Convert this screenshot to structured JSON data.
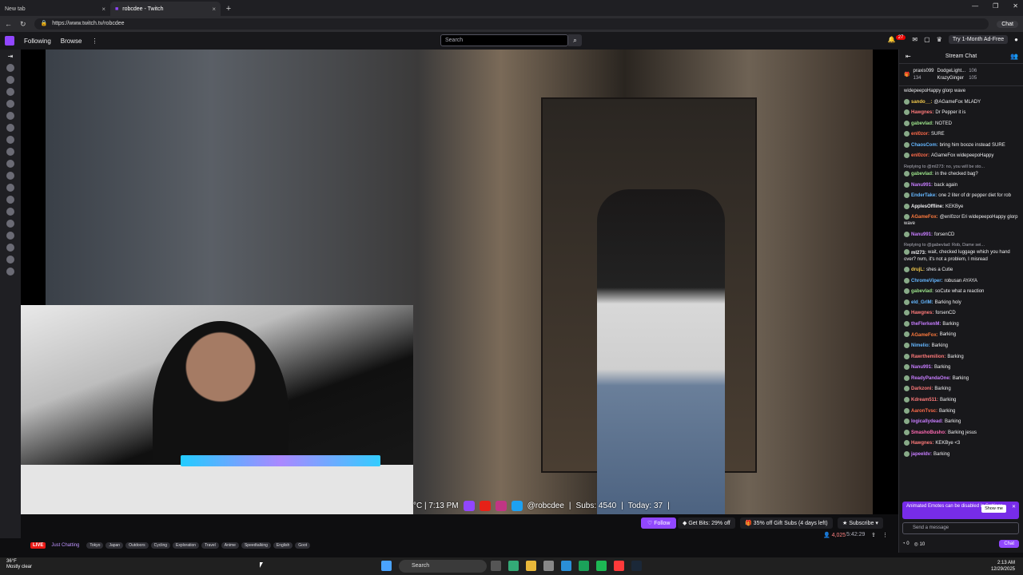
{
  "browser": {
    "tabs": [
      {
        "title": "New tab",
        "active": false
      },
      {
        "title": "robcdee - Twitch",
        "active": true
      }
    ],
    "url": "https://www.twitch.tv/robcdee",
    "chat_button": "Chat"
  },
  "twitch_nav": {
    "following": "Following",
    "browse": "Browse",
    "search_placeholder": "Search",
    "notification_count": "27",
    "ad_free": "Try 1-Month Ad-Free"
  },
  "stream": {
    "ticker": {
      "time": "°C | 7:13 PM",
      "handle": "@robcdee",
      "subs": "Subs: 4540",
      "today": "Today: 37"
    },
    "follow_label": "Follow",
    "bits_label": "Get Bits: 29% off",
    "gift_label": "35% off Gift Subs (4 days left)",
    "subscribe_label": "Subscribe",
    "viewers": "4,025",
    "uptime": "5:42:29",
    "live_label": "LIVE",
    "category": "Just Chatting",
    "tags": [
      "Tokyo",
      "Japan",
      "Outdoors",
      "Cycling",
      "Exploration",
      "Travel",
      "Anime",
      "Speedtalking",
      "English",
      "Goot"
    ]
  },
  "chat": {
    "title": "Stream Chat",
    "gifters": [
      {
        "name": "praxis099",
        "count": "134"
      },
      {
        "name": "DodgeLight...",
        "count": "106"
      },
      {
        "name": "KrazyGinger",
        "count": "105"
      }
    ],
    "messages": [
      {
        "user": "",
        "text": "widepeepoHappy glorp wave",
        "color": "#efeff1"
      },
      {
        "user": "sando__:",
        "text": "@AGameFox MLADY",
        "color": "#f2c94c"
      },
      {
        "user": "Hawgnes:",
        "text": "Dr Pepper it is",
        "color": "#ff7a7a"
      },
      {
        "user": "gabevlad:",
        "text": "NOTED",
        "color": "#9be28a"
      },
      {
        "user": "enl0zor:",
        "text": "SURE",
        "color": "#ff6b4a"
      },
      {
        "user": "ChaosCom:",
        "text": "bring him booze instead SURE",
        "color": "#65b7ff"
      },
      {
        "user": "enl0zor:",
        "text": "AGameFox widepeepoHappy",
        "color": "#ff6b4a"
      },
      {
        "user": "gabevlad:",
        "text": "in the checked bag?",
        "color": "#9be28a",
        "reply": "Replying to @ml273: no, you will be sto..."
      },
      {
        "user": "Nanu991:",
        "text": "back again",
        "color": "#c77dff"
      },
      {
        "user": "EnderTake:",
        "text": "one 2 liter of dr pepper diet for rob",
        "color": "#65b7ff"
      },
      {
        "user": "ApplesOffline:",
        "text": "KEKBye",
        "color": "#efeff1"
      },
      {
        "user": "AGameFox:",
        "text": "@enl0zor Eri widepeepoHappy glorp wave",
        "color": "#ff7a3d"
      },
      {
        "user": "Nanu991:",
        "text": "forsenCD",
        "color": "#c77dff"
      },
      {
        "user": "ml273:",
        "text": "wait, checked luggage which you hand over? nvm, it's not a problem, I misread",
        "color": "#efeff1",
        "reply": "Replying to @gabevlad: Rob, Dame sei..."
      },
      {
        "user": "drujL:",
        "text": "shes a Cutie",
        "color": "#f2c94c"
      },
      {
        "user": "ChromeViper:",
        "text": "robusan AYAYA",
        "color": "#65b7ff"
      },
      {
        "user": "gabevlad:",
        "text": "soCute what a reaction",
        "color": "#9be28a"
      },
      {
        "user": "eld_GrIM:",
        "text": "Barking holy",
        "color": "#65b7ff"
      },
      {
        "user": "Hawgnes:",
        "text": "forsenCD",
        "color": "#ff7a7a"
      },
      {
        "user": "theFlerkenM:",
        "text": "Barking",
        "color": "#c77dff"
      },
      {
        "user": "AGameFox:",
        "text": "Barking",
        "color": "#ff7a3d"
      },
      {
        "user": "Nimelio:",
        "text": "Barking",
        "color": "#65b7ff"
      },
      {
        "user": "Rawrthemilion:",
        "text": "Barking",
        "color": "#ff7a7a"
      },
      {
        "user": "Nanu991:",
        "text": "Barking",
        "color": "#c77dff"
      },
      {
        "user": "ReadyPandaOne:",
        "text": "Barking",
        "color": "#c77dff"
      },
      {
        "user": "Darkzoni:",
        "text": "Barking",
        "color": "#ff7a7a"
      },
      {
        "user": "Kdream511:",
        "text": "Barking",
        "color": "#ff7a7a"
      },
      {
        "user": "AaronTvsc:",
        "text": "Barking",
        "color": "#ff6b4a"
      },
      {
        "user": "logicallydead:",
        "text": "Barking",
        "color": "#c77dff"
      },
      {
        "user": "SmashoBusho:",
        "text": "Barking jesus",
        "color": "#ff6ab3"
      },
      {
        "user": "Hawgnes:",
        "text": "KEKBye <3",
        "color": "#ff7a7a"
      },
      {
        "user": "japeeldv:",
        "text": "Barking",
        "color": "#c77dff"
      }
    ],
    "notice": "Animated Emotes can be disabled in Settings",
    "notice_button": "Show me",
    "input_placeholder": "Send a message",
    "points": "0",
    "cheer": "10",
    "send_label": "Chat"
  },
  "taskbar": {
    "temp": "36°F",
    "weather": "Mostly clear",
    "search": "Search",
    "time": "2:13 AM",
    "date": "12/29/2025"
  }
}
